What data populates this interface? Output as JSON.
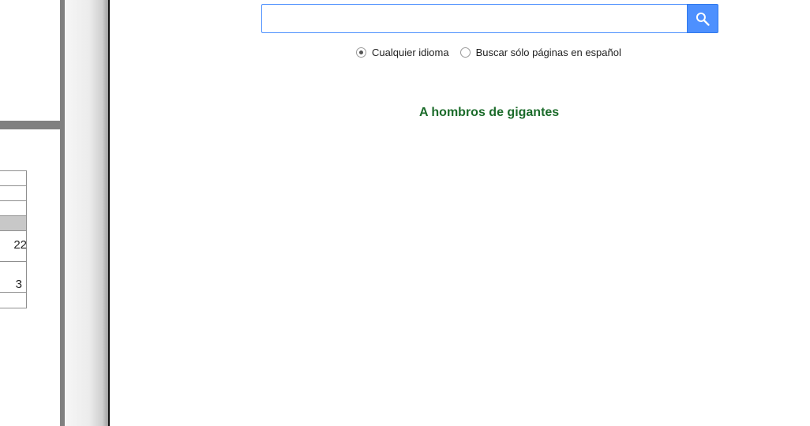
{
  "background_page": {
    "table_rows": [
      {
        "text": "",
        "type": "normal"
      },
      {
        "text": "",
        "type": "normal"
      },
      {
        "text": "",
        "type": "normal"
      },
      {
        "text": "",
        "type": "header"
      },
      {
        "text": "22",
        "type": "tall"
      },
      {
        "text": "3",
        "type": "tall"
      },
      {
        "text": "",
        "type": "normal"
      }
    ]
  },
  "search": {
    "value": "",
    "placeholder": "",
    "button_icon": "search-icon",
    "accent_color": "#4d90fe"
  },
  "language_options": [
    {
      "label": "Cualquier idioma",
      "checked": true
    },
    {
      "label": "Buscar sólo páginas en español",
      "checked": false
    }
  ],
  "tagline": {
    "text": "A hombros de gigantes",
    "color": "#1b6b2a"
  }
}
